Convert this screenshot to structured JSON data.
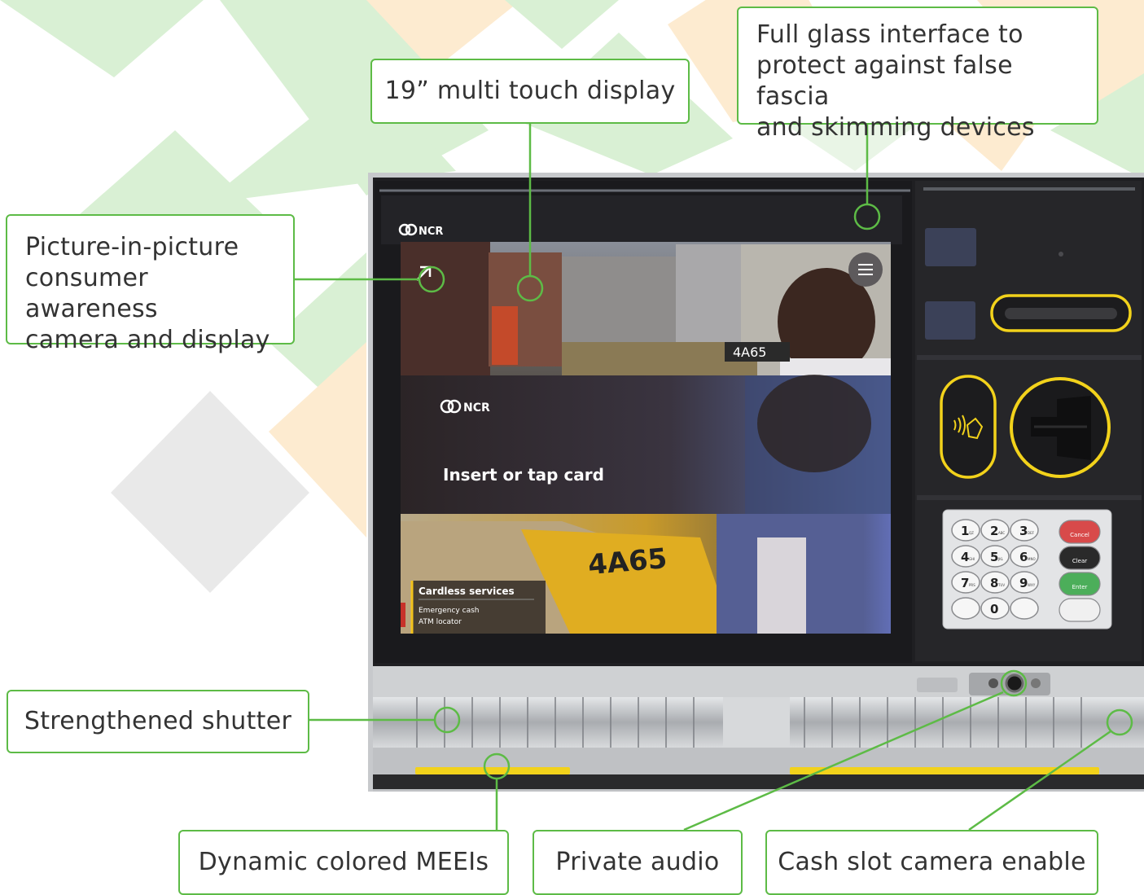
{
  "colors": {
    "accent": "#5dbb46",
    "bg_green": "#d9f0d4",
    "bg_orange": "#fdebd0",
    "bg_gray": "#e9e9e9",
    "led_yellow": "#f2d21b",
    "fascia_dark": "#262629",
    "metal": "#b6b8bb"
  },
  "callouts": {
    "pip": [
      "Picture-in-picture",
      "consumer awareness",
      "camera and display"
    ],
    "touch": "19” multi touch display",
    "glass": [
      "Full glass interface to",
      "protect against false fascia",
      "and skimming devices"
    ],
    "shutter": "Strengthened shutter",
    "meei": "Dynamic colored MEEIs",
    "audio": "Private audio",
    "cash": "Cash slot camera enable"
  },
  "screen": {
    "brand_top": "NCR",
    "brand_mid": "NCR",
    "prompt": "Insert or tap card",
    "plate_top": "4A65",
    "plate_bottom": "4A65",
    "cardless_title": "Cardless services",
    "cardless_items": [
      "Emergency cash",
      "ATM locator"
    ]
  },
  "keypad": {
    "keys": [
      {
        "main": "1",
        "sub": "QZ"
      },
      {
        "main": "2",
        "sub": "ABC"
      },
      {
        "main": "3",
        "sub": "DEF"
      },
      {
        "main": "4",
        "sub": "GHI"
      },
      {
        "main": "5",
        "sub": "JKL"
      },
      {
        "main": "6",
        "sub": "MNO"
      },
      {
        "main": "7",
        "sub": "PRS"
      },
      {
        "main": "8",
        "sub": "TUV"
      },
      {
        "main": "9",
        "sub": "WXY"
      },
      {
        "main": "",
        "sub": ""
      },
      {
        "main": "0",
        "sub": ""
      },
      {
        "main": "",
        "sub": ""
      }
    ],
    "functions": [
      {
        "label": "Cancel",
        "color": "#d84a4a"
      },
      {
        "label": "Clear",
        "color": "#2a2a2a"
      },
      {
        "label": "Enter",
        "color": "#4cae5a"
      },
      {
        "label": "",
        "color": "#f0f0f0"
      }
    ]
  },
  "icons": {
    "contactless": "contactless-hand-icon",
    "menu": "hamburger-menu-icon"
  }
}
